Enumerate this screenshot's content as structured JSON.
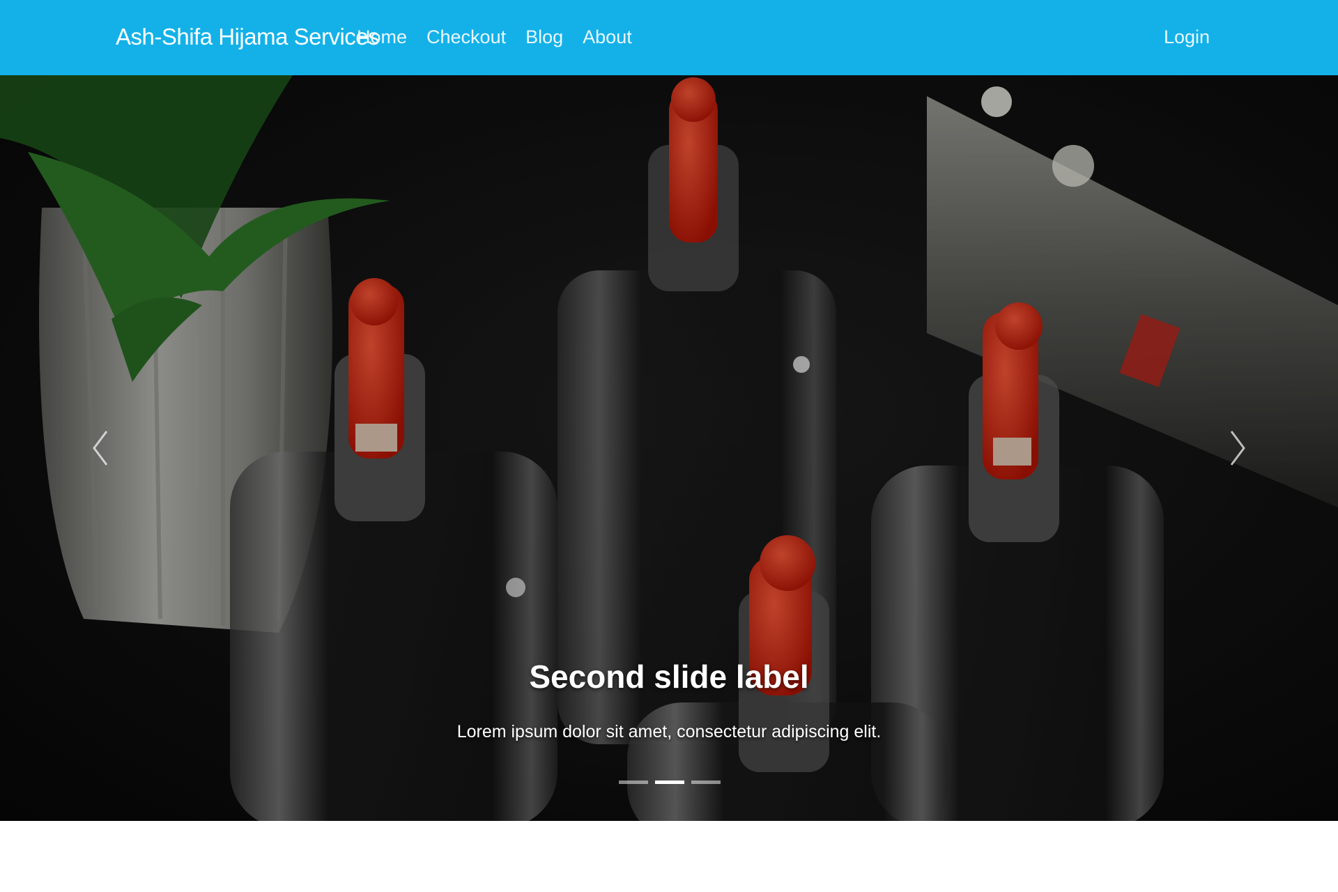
{
  "navbar": {
    "brand": "Ash-Shifa Hijama Services",
    "links": [
      "Home",
      "Checkout",
      "Blog",
      "About"
    ],
    "login": "Login",
    "background": "#13b1e8"
  },
  "carousel": {
    "caption_title": "Second slide label",
    "caption_text": "Lorem ipsum dolor sit amet, consectetur adipiscing elit.",
    "active_slide": 2,
    "slide_count": 3,
    "prev_icon": "chevron-left-icon",
    "next_icon": "chevron-right-icon",
    "image": "cupping-glasses-photo"
  }
}
